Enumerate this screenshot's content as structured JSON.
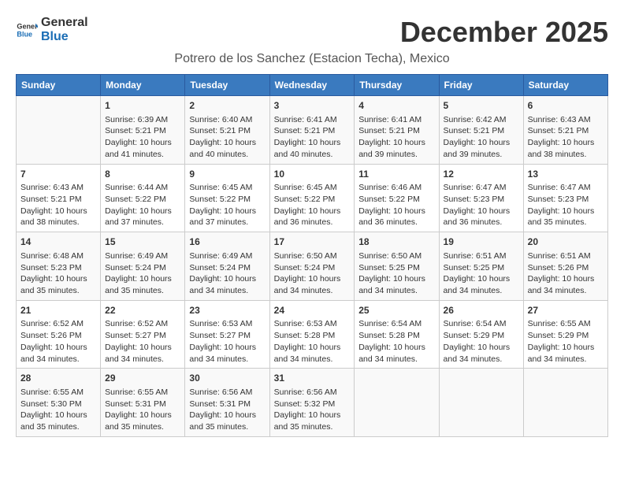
{
  "logo": {
    "text_general": "General",
    "text_blue": "Blue"
  },
  "header": {
    "month_title": "December 2025",
    "subtitle": "Potrero de los Sanchez (Estacion Techa), Mexico"
  },
  "weekdays": [
    "Sunday",
    "Monday",
    "Tuesday",
    "Wednesday",
    "Thursday",
    "Friday",
    "Saturday"
  ],
  "weeks": [
    [
      {
        "day": "",
        "content": ""
      },
      {
        "day": "1",
        "content": "Sunrise: 6:39 AM\nSunset: 5:21 PM\nDaylight: 10 hours and 41 minutes."
      },
      {
        "day": "2",
        "content": "Sunrise: 6:40 AM\nSunset: 5:21 PM\nDaylight: 10 hours and 40 minutes."
      },
      {
        "day": "3",
        "content": "Sunrise: 6:41 AM\nSunset: 5:21 PM\nDaylight: 10 hours and 40 minutes."
      },
      {
        "day": "4",
        "content": "Sunrise: 6:41 AM\nSunset: 5:21 PM\nDaylight: 10 hours and 39 minutes."
      },
      {
        "day": "5",
        "content": "Sunrise: 6:42 AM\nSunset: 5:21 PM\nDaylight: 10 hours and 39 minutes."
      },
      {
        "day": "6",
        "content": "Sunrise: 6:43 AM\nSunset: 5:21 PM\nDaylight: 10 hours and 38 minutes."
      }
    ],
    [
      {
        "day": "7",
        "content": "Sunrise: 6:43 AM\nSunset: 5:21 PM\nDaylight: 10 hours and 38 minutes."
      },
      {
        "day": "8",
        "content": "Sunrise: 6:44 AM\nSunset: 5:22 PM\nDaylight: 10 hours and 37 minutes."
      },
      {
        "day": "9",
        "content": "Sunrise: 6:45 AM\nSunset: 5:22 PM\nDaylight: 10 hours and 37 minutes."
      },
      {
        "day": "10",
        "content": "Sunrise: 6:45 AM\nSunset: 5:22 PM\nDaylight: 10 hours and 36 minutes."
      },
      {
        "day": "11",
        "content": "Sunrise: 6:46 AM\nSunset: 5:22 PM\nDaylight: 10 hours and 36 minutes."
      },
      {
        "day": "12",
        "content": "Sunrise: 6:47 AM\nSunset: 5:23 PM\nDaylight: 10 hours and 36 minutes."
      },
      {
        "day": "13",
        "content": "Sunrise: 6:47 AM\nSunset: 5:23 PM\nDaylight: 10 hours and 35 minutes."
      }
    ],
    [
      {
        "day": "14",
        "content": "Sunrise: 6:48 AM\nSunset: 5:23 PM\nDaylight: 10 hours and 35 minutes."
      },
      {
        "day": "15",
        "content": "Sunrise: 6:49 AM\nSunset: 5:24 PM\nDaylight: 10 hours and 35 minutes."
      },
      {
        "day": "16",
        "content": "Sunrise: 6:49 AM\nSunset: 5:24 PM\nDaylight: 10 hours and 34 minutes."
      },
      {
        "day": "17",
        "content": "Sunrise: 6:50 AM\nSunset: 5:24 PM\nDaylight: 10 hours and 34 minutes."
      },
      {
        "day": "18",
        "content": "Sunrise: 6:50 AM\nSunset: 5:25 PM\nDaylight: 10 hours and 34 minutes."
      },
      {
        "day": "19",
        "content": "Sunrise: 6:51 AM\nSunset: 5:25 PM\nDaylight: 10 hours and 34 minutes."
      },
      {
        "day": "20",
        "content": "Sunrise: 6:51 AM\nSunset: 5:26 PM\nDaylight: 10 hours and 34 minutes."
      }
    ],
    [
      {
        "day": "21",
        "content": "Sunrise: 6:52 AM\nSunset: 5:26 PM\nDaylight: 10 hours and 34 minutes."
      },
      {
        "day": "22",
        "content": "Sunrise: 6:52 AM\nSunset: 5:27 PM\nDaylight: 10 hours and 34 minutes."
      },
      {
        "day": "23",
        "content": "Sunrise: 6:53 AM\nSunset: 5:27 PM\nDaylight: 10 hours and 34 minutes."
      },
      {
        "day": "24",
        "content": "Sunrise: 6:53 AM\nSunset: 5:28 PM\nDaylight: 10 hours and 34 minutes."
      },
      {
        "day": "25",
        "content": "Sunrise: 6:54 AM\nSunset: 5:28 PM\nDaylight: 10 hours and 34 minutes."
      },
      {
        "day": "26",
        "content": "Sunrise: 6:54 AM\nSunset: 5:29 PM\nDaylight: 10 hours and 34 minutes."
      },
      {
        "day": "27",
        "content": "Sunrise: 6:55 AM\nSunset: 5:29 PM\nDaylight: 10 hours and 34 minutes."
      }
    ],
    [
      {
        "day": "28",
        "content": "Sunrise: 6:55 AM\nSunset: 5:30 PM\nDaylight: 10 hours and 35 minutes."
      },
      {
        "day": "29",
        "content": "Sunrise: 6:55 AM\nSunset: 5:31 PM\nDaylight: 10 hours and 35 minutes."
      },
      {
        "day": "30",
        "content": "Sunrise: 6:56 AM\nSunset: 5:31 PM\nDaylight: 10 hours and 35 minutes."
      },
      {
        "day": "31",
        "content": "Sunrise: 6:56 AM\nSunset: 5:32 PM\nDaylight: 10 hours and 35 minutes."
      },
      {
        "day": "",
        "content": ""
      },
      {
        "day": "",
        "content": ""
      },
      {
        "day": "",
        "content": ""
      }
    ]
  ]
}
